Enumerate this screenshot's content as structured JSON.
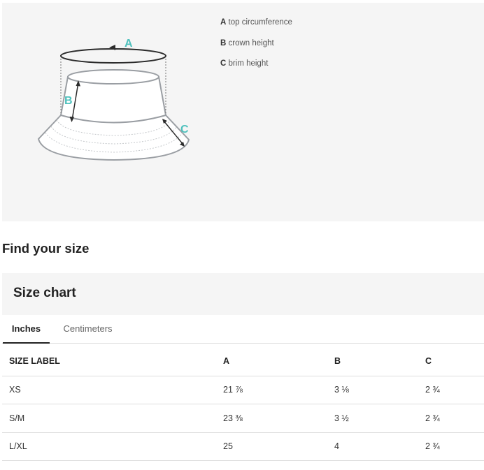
{
  "diagram": {
    "labels": {
      "a": "A",
      "b": "B",
      "c": "C"
    },
    "label_color": "#4fc1bd",
    "legend": [
      {
        "key": "A",
        "text": "top circumference"
      },
      {
        "key": "B",
        "text": "crown height"
      },
      {
        "key": "C",
        "text": "brim height"
      }
    ]
  },
  "find_title": "Find your size",
  "chart_title": "Size chart",
  "tabs": [
    {
      "label": "Inches",
      "active": true
    },
    {
      "label": "Centimeters",
      "active": false
    }
  ],
  "table": {
    "headers": [
      "SIZE LABEL",
      "A",
      "B",
      "C"
    ],
    "rows": [
      [
        "XS",
        "21 ⅞",
        "3 ⅛",
        "2 ¾"
      ],
      [
        "S/M",
        "23 ⅜",
        "3 ½",
        "2 ¾"
      ],
      [
        "L/XL",
        "25",
        "4",
        "2 ¾"
      ]
    ]
  }
}
